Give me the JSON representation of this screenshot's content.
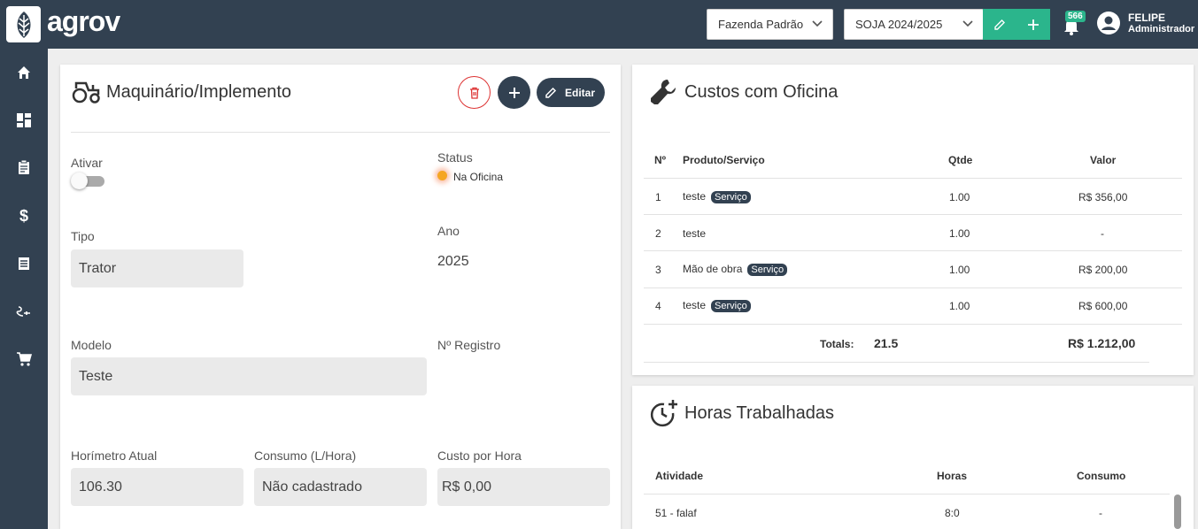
{
  "header": {
    "logo_text": "agrov",
    "farm_select": "Fazenda Padrão",
    "season_select": "SOJA 2024/2025",
    "notifications_count": "566",
    "user_name": "FELIPE",
    "user_role": "Administrador"
  },
  "sidebar": {
    "items": [
      "home-icon",
      "dashboard-icon",
      "clipboard-icon",
      "dollar-icon",
      "storage-icon",
      "tractor-route-icon",
      "cart-icon"
    ]
  },
  "machine": {
    "title": "Maquinário/Implemento",
    "edit_label": "Editar",
    "ativar_label": "Ativar",
    "status_label": "Status",
    "status_value": "Na Oficina",
    "tipo_label": "Tipo",
    "tipo_value": "Trator",
    "ano_label": "Ano",
    "ano_value": "2025",
    "modelo_label": "Modelo",
    "modelo_value": "Teste",
    "registro_label": "Nº Registro",
    "horimetro_label": "Horímetro Atual",
    "horimetro_value": "106.30",
    "consumo_label": "Consumo (L/Hora)",
    "consumo_value": "Não cadastrado",
    "custo_label": "Custo por Hora",
    "custo_value": "R$ 0,00"
  },
  "custos": {
    "title": "Custos com Oficina",
    "headers": [
      "Nº",
      "Produto/Serviço",
      "Qtde",
      "Valor"
    ],
    "rows": [
      {
        "n": "1",
        "produto": "teste",
        "tag": "Serviço",
        "qtde": "1.00",
        "valor": "R$ 356,00"
      },
      {
        "n": "2",
        "produto": "teste",
        "tag": "",
        "qtde": "1.00",
        "valor": "-"
      },
      {
        "n": "3",
        "produto": "Mão de obra",
        "tag": "Serviço",
        "qtde": "1.00",
        "valor": "R$ 200,00"
      },
      {
        "n": "4",
        "produto": "teste",
        "tag": "Serviço",
        "qtde": "1.00",
        "valor": "R$ 600,00"
      }
    ],
    "totals_label": "Totals:",
    "totals_qtde": "21.5",
    "totals_valor": "R$ 1.212,00"
  },
  "horas": {
    "title": "Horas Trabalhadas",
    "headers": [
      "Atividade",
      "Horas",
      "Consumo"
    ],
    "rows": [
      {
        "atividade": "51 - falaf",
        "horas": "8:0",
        "consumo": "-"
      }
    ]
  }
}
